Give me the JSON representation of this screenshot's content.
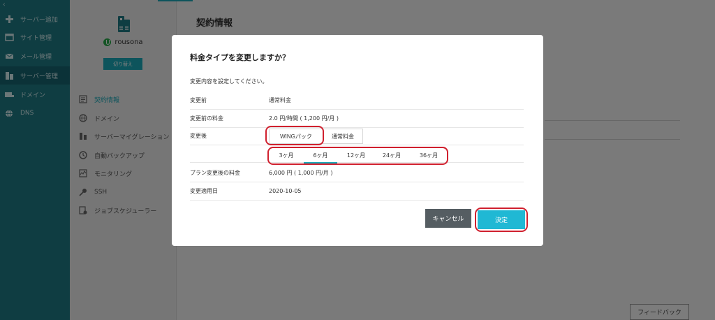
{
  "nav": {
    "collapse_icon": "chevron-left-icon",
    "items": [
      {
        "label": "サーバー追加",
        "icon": "plus-icon"
      },
      {
        "label": "サイト管理",
        "icon": "window-icon"
      },
      {
        "label": "メール管理",
        "icon": "mail-icon"
      },
      {
        "label": "サーバー管理",
        "icon": "server-icon"
      },
      {
        "label": "ドメイン",
        "icon": "domain-icon"
      },
      {
        "label": "DNS",
        "icon": "globe-icon"
      }
    ]
  },
  "server": {
    "name": "rousona",
    "switch_label": "切り替え"
  },
  "menu": {
    "items": [
      {
        "label": "契約情報",
        "icon": "document-icon"
      },
      {
        "label": "ドメイン",
        "icon": "globe-icon"
      },
      {
        "label": "サーバーマイグレーション",
        "icon": "migration-icon"
      },
      {
        "label": "自動バックアップ",
        "icon": "backup-icon"
      },
      {
        "label": "モニタリング",
        "icon": "monitor-icon"
      },
      {
        "label": "SSH",
        "icon": "key-icon"
      },
      {
        "label": "ジョブスケジューラー",
        "icon": "scheduler-icon"
      }
    ]
  },
  "page": {
    "title": "契約情報",
    "feedback_label": "フィードバック"
  },
  "modal": {
    "title": "料金タイプを変更しますか？",
    "subtitle": "変更内容を設定してください。",
    "rows": {
      "before_label": "変更前",
      "before_value": "通常料金",
      "before_price_label": "変更前の料金",
      "before_price_value": "2.0 円/時間 ( 1,200 円/月 )",
      "after_label": "変更後",
      "plan_price_label": "プラン変更後の料金",
      "plan_price_value": "6,000 円 ( 1,000 円/月 )",
      "apply_date_label": "変更適用日",
      "apply_date_value": "2020-10-05"
    },
    "types": [
      "WINGパック",
      "通常料金"
    ],
    "durations": [
      "3ヶ月",
      "6ヶ月",
      "12ヶ月",
      "24ヶ月",
      "36ヶ月"
    ],
    "selected_duration": "6ヶ月",
    "cancel_label": "キャンセル",
    "ok_label": "決定"
  },
  "colors": {
    "nav_bg": "#1e7a85",
    "accent": "#1aa9b8",
    "ok_button": "#20b8d4",
    "cancel_button": "#555d62",
    "annotation_red": "#d0202e"
  }
}
